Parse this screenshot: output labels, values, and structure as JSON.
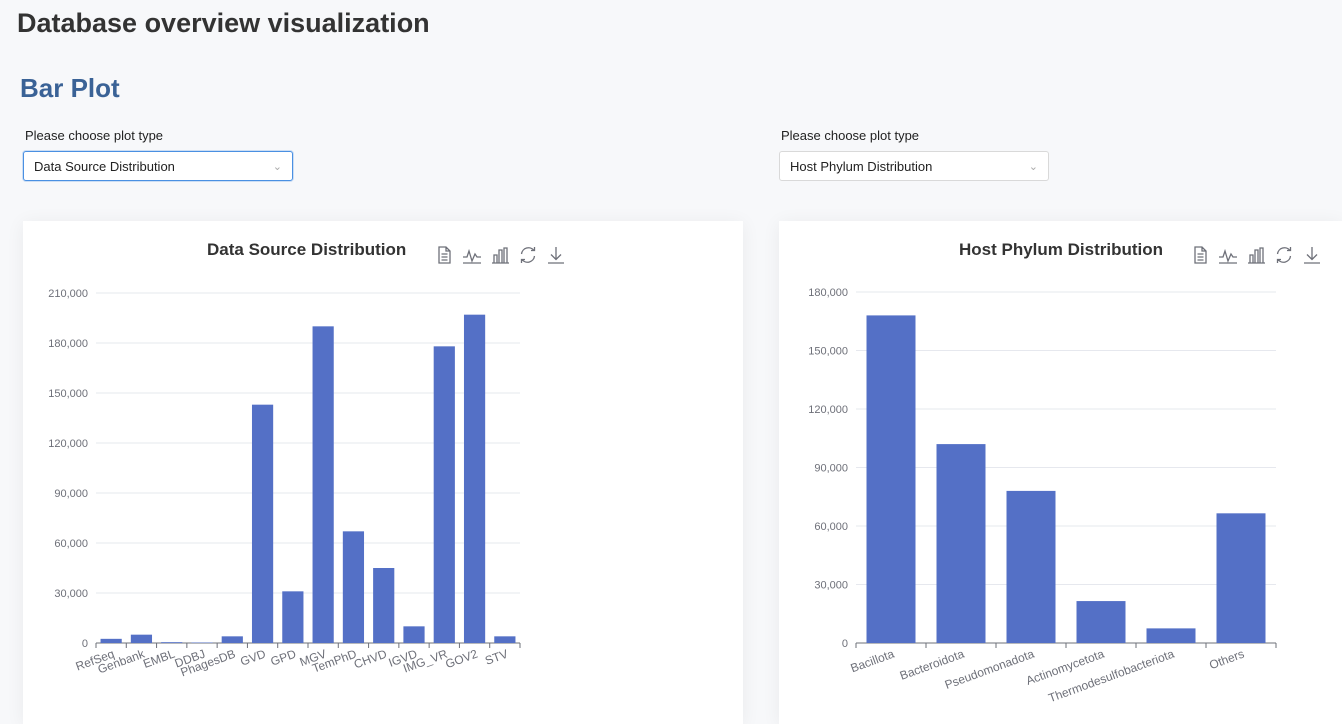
{
  "page": {
    "title": "Database overview visualization",
    "section_title": "Bar Plot"
  },
  "left_select": {
    "label": "Please choose plot type",
    "value": "Data Source Distribution"
  },
  "right_select": {
    "label": "Please choose plot type",
    "value": "Host Phylum Distribution"
  },
  "toolbox": [
    "data-view-icon",
    "line-chart-icon",
    "bar-chart-icon",
    "restore-icon",
    "download-icon"
  ],
  "colors": {
    "bar": "#5470c6",
    "accent": "#3a6296"
  },
  "chart_data": [
    {
      "type": "bar",
      "title": "Data Source Distribution",
      "categories": [
        "RefSeq",
        "Genbank",
        "EMBL",
        "DDBJ",
        "PhagesDB",
        "GVD",
        "GPD",
        "MGV",
        "TemPhD",
        "CHVD",
        "IGVD",
        "IMG_VR",
        "GOV2",
        "STV"
      ],
      "values": [
        2500,
        5000,
        500,
        300,
        4000,
        143000,
        31000,
        190000,
        67000,
        45000,
        10000,
        178000,
        197000,
        4000
      ],
      "ylim": [
        0,
        210000
      ],
      "yticks": [
        "0",
        "30,000",
        "60,000",
        "90,000",
        "120,000",
        "150,000",
        "180,000",
        "210,000"
      ],
      "xlabel": "",
      "ylabel": ""
    },
    {
      "type": "bar",
      "title": "Host Phylum Distribution",
      "categories": [
        "Bacillota",
        "Bacteroidota",
        "Pseudomonadota",
        "Actinomycetota",
        "Thermodesulfobacteriota",
        "Others"
      ],
      "values": [
        168000,
        102000,
        78000,
        21500,
        7500,
        66500
      ],
      "ylim": [
        0,
        180000
      ],
      "yticks": [
        "0",
        "30,000",
        "60,000",
        "90,000",
        "120,000",
        "150,000",
        "180,000"
      ],
      "xlabel": "",
      "ylabel": ""
    }
  ]
}
